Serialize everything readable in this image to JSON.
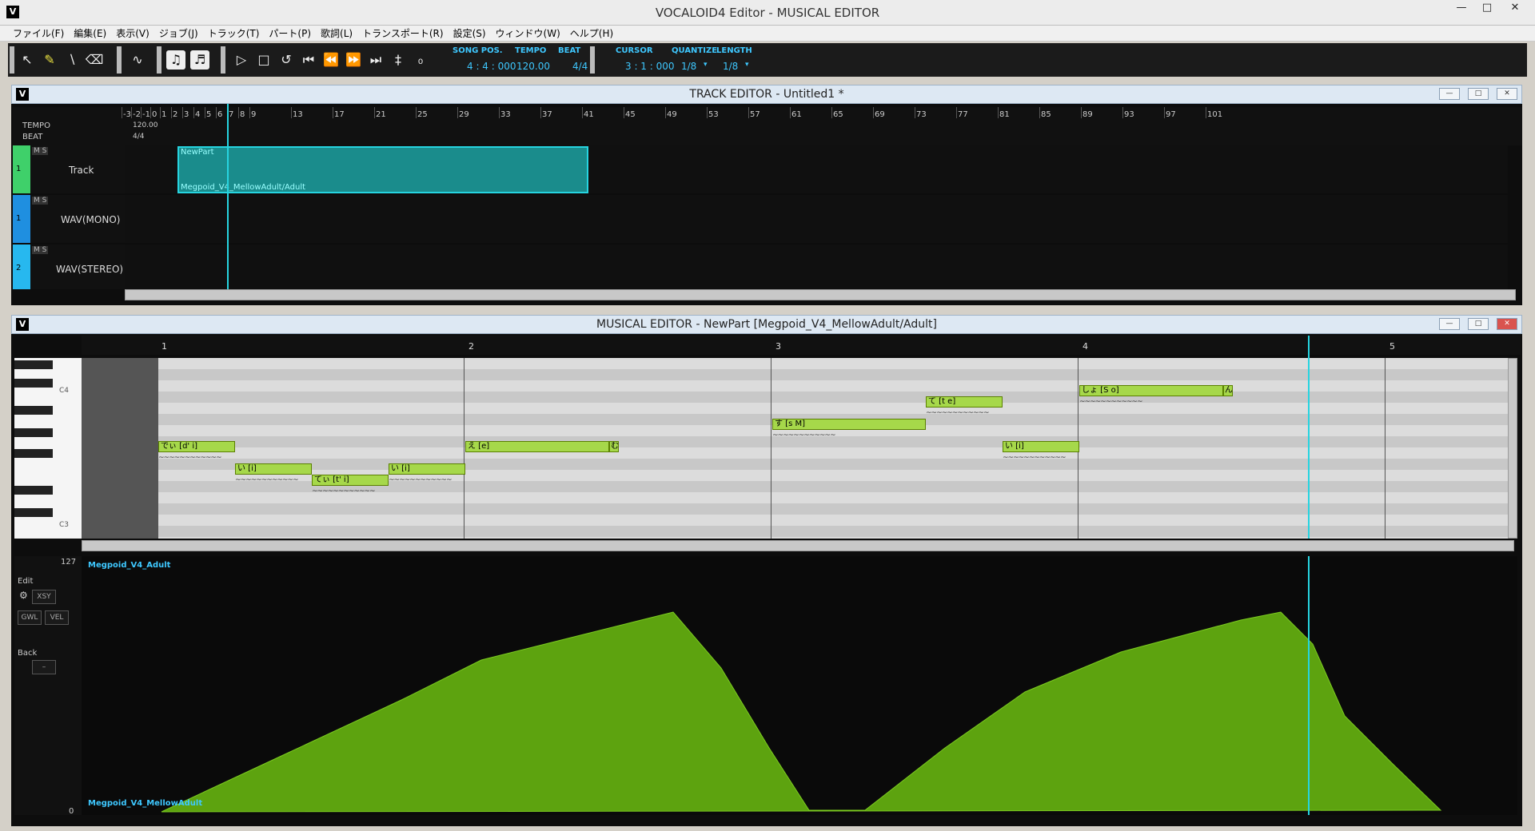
{
  "window": {
    "title": "VOCALOID4 Editor - MUSICAL EDITOR",
    "icon_letter": "V"
  },
  "menu": [
    "ファイル(F)",
    "編集(E)",
    "表示(V)",
    "ジョブ(J)",
    "トラック(T)",
    "パート(P)",
    "歌詞(L)",
    "トランスポート(R)",
    "設定(S)",
    "ウィンドウ(W)",
    "ヘルプ(H)"
  ],
  "toolbar": {
    "song_pos_label": "SONG POS.",
    "song_pos": "4 : 4 : 000",
    "tempo_label": "TEMPO",
    "tempo": "120.00",
    "beat_label": "BEAT",
    "beat": "4/4",
    "cursor_label": "CURSOR",
    "cursor": "3 : 1 : 000",
    "quantize_label": "QUANTIZE",
    "quantize": "1/8",
    "length_label": "LENGTH",
    "length": "1/8"
  },
  "track_editor": {
    "title": "TRACK EDITOR - Untitled1 *",
    "tempo_label": "TEMPO",
    "beat_label": "BEAT",
    "tempo_value": "120.00",
    "beat_value": "4/4",
    "timeline": [
      "-3",
      "-2",
      "-1",
      "0",
      "1",
      "2",
      "3",
      "4",
      "5",
      "6",
      "7",
      "8",
      "9",
      "13",
      "17",
      "21",
      "25",
      "29",
      "33",
      "37",
      "41",
      "45",
      "49",
      "53",
      "57",
      "61",
      "65",
      "69",
      "73",
      "77",
      "81",
      "85",
      "89",
      "93",
      "97",
      "101"
    ],
    "tracks": [
      {
        "num": "1",
        "name": "Track",
        "ms": "M S",
        "color": "#3fd06a"
      },
      {
        "num": "1",
        "name": "WAV(MONO)",
        "ms": "M S",
        "color": "#1f8fe0"
      },
      {
        "num": "2",
        "name": "WAV(STEREO)",
        "ms": "M S",
        "color": "#27b8ef"
      }
    ],
    "part": {
      "name": "NewPart",
      "singer": "Megpoid_V4_MellowAdult/Adult"
    }
  },
  "musical_editor": {
    "title": "MUSICAL EDITOR - NewPart [Megpoid_V4_MellowAdult/Adult]",
    "bars": [
      "1",
      "2",
      "3",
      "4",
      "5"
    ],
    "key_labels": {
      "c4": "C4",
      "c3": "C3"
    },
    "notes": [
      {
        "lyric": "でぃ [d' i]"
      },
      {
        "lyric": "い [i]"
      },
      {
        "lyric": "てぃ [t' i]"
      },
      {
        "lyric": "い [i]"
      },
      {
        "lyric": "え [e]"
      },
      {
        "lyric": "む"
      },
      {
        "lyric": "す [s M]"
      },
      {
        "lyric": "て [t e]"
      },
      {
        "lyric": "い [i]"
      },
      {
        "lyric": "しょ [S o]"
      },
      {
        "lyric": "ん"
      }
    ],
    "vibrato_glyph": "~~~~~~~~~~~~"
  },
  "control_track": {
    "max": "127",
    "min": "0",
    "edit_label": "Edit",
    "param": "XSY",
    "gwl": "GWL",
    "vel": "VEL",
    "back_label": "Back",
    "back_value": "–",
    "singer_top": "Megpoid_V4_Adult",
    "singer_bottom": "Megpoid_V4_MellowAdult"
  },
  "colors": {
    "accent": "#3ec8ff",
    "note": "#a6d84a",
    "curve": "#5da30f"
  }
}
